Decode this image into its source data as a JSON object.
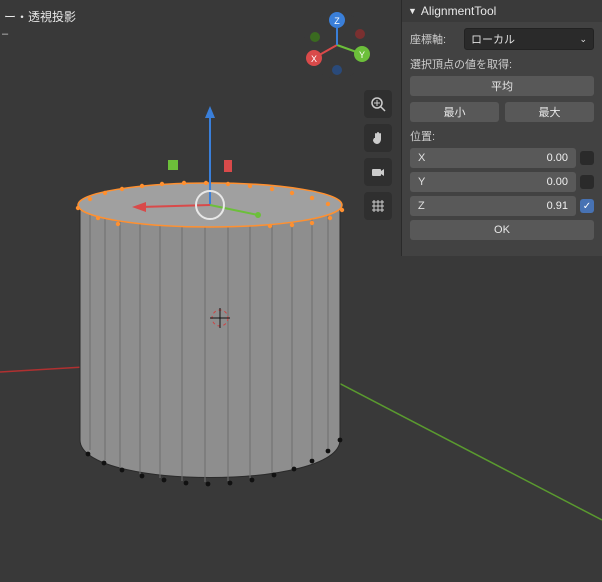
{
  "header": {
    "view_mode": "ー・透視投影"
  },
  "axis_gizmo": {
    "x": "X",
    "y": "Y",
    "z": "Z"
  },
  "toolbar_icons": [
    "zoom-icon",
    "pan-icon",
    "camera-icon",
    "grid-icon"
  ],
  "panel": {
    "title": "AlignmentTool",
    "coord_label": "座標軸:",
    "coord_value": "ローカル",
    "get_selection_label": "選択頂点の値を取得:",
    "avg_button": "平均",
    "min_button": "最小",
    "max_button": "最大",
    "pos_label": "位置:",
    "fields": {
      "x": {
        "label": "X",
        "value": "0.00",
        "enabled": false
      },
      "y": {
        "label": "Y",
        "value": "0.00",
        "enabled": false
      },
      "z": {
        "label": "Z",
        "value": "0.91",
        "enabled": true
      }
    },
    "ok_button": "OK"
  },
  "colors": {
    "x_axis": "#d94a4a",
    "y_axis": "#6cbf3a",
    "z_axis": "#3a7fd9",
    "select": "#ff9030"
  }
}
